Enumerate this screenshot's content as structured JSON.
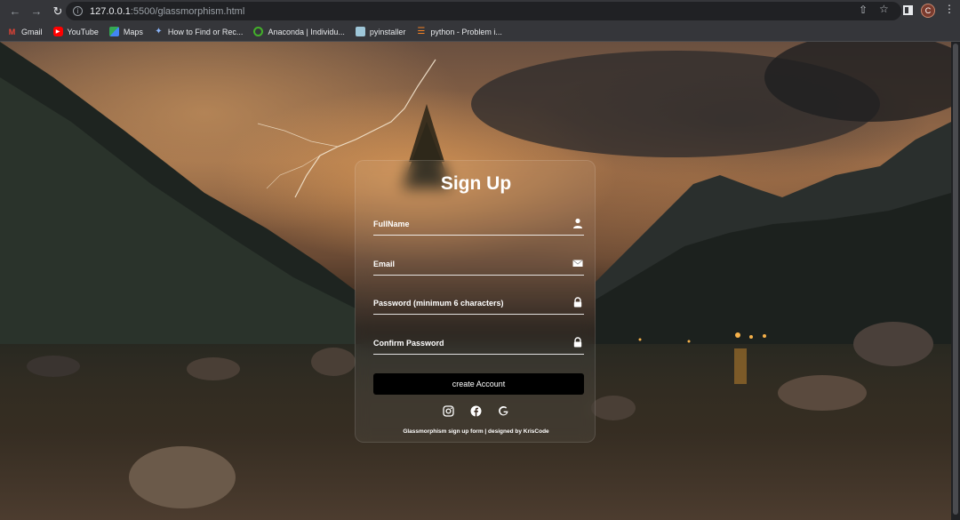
{
  "browser": {
    "url_host": "127.0.0.1",
    "url_path": ":5500/glassmorphism.html",
    "avatar_letter": "C"
  },
  "bookmarks": [
    {
      "label": "Gmail",
      "icon": "gmail-icon"
    },
    {
      "label": "YouTube",
      "icon": "youtube-icon"
    },
    {
      "label": "Maps",
      "icon": "maps-icon"
    },
    {
      "label": "How to Find or Rec...",
      "icon": "bookmark-icon"
    },
    {
      "label": "Anaconda | Individu...",
      "icon": "anaconda-icon"
    },
    {
      "label": "pyinstaller",
      "icon": "pyinstaller-icon"
    },
    {
      "label": "python - Problem i...",
      "icon": "stackoverflow-icon"
    }
  ],
  "form": {
    "title": "Sign Up",
    "fields": [
      {
        "label": "FullName",
        "icon": "user-icon"
      },
      {
        "label": "Email",
        "icon": "envelope-icon"
      },
      {
        "label": "Password (minimum 6 characters)",
        "icon": "lock-icon"
      },
      {
        "label": "Confirm Password",
        "icon": "lock-icon"
      }
    ],
    "submit_label": "create Account",
    "socials": [
      "instagram-icon",
      "facebook-icon",
      "google-icon"
    ],
    "credit": "Glassmorphism sign up form | designed by KrisCode"
  },
  "colors": {
    "accent": "#000000",
    "text": "#ffffff"
  }
}
